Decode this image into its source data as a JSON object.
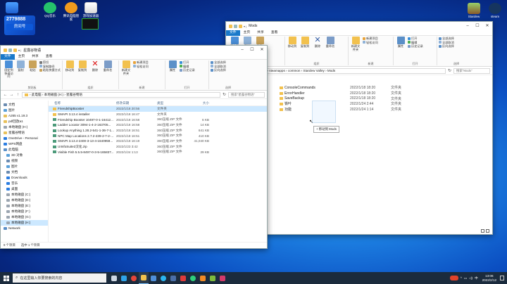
{
  "desktop": {
    "icons": [
      {
        "label": "房间号",
        "color": "#2a7de1",
        "id": "room"
      },
      {
        "label": "QQ音乐",
        "color": "#25c26b",
        "id": "qqmusic"
      },
      {
        "label": "腾讯电脑管家",
        "color": "#f09a1e",
        "id": "pcmgr"
      },
      {
        "label": "游戏加速器",
        "color": "#e83b3b",
        "id": "booster"
      },
      {
        "label": "Stardew",
        "color": "#8a5a2b",
        "id": "stardew"
      },
      {
        "label": "steam",
        "color": "#16355f",
        "id": "steam"
      }
    ],
    "banner_label": "房间号",
    "banner_number": "2779888"
  },
  "modsWindow": {
    "title": "Mods",
    "tabs": [
      "文件",
      "主页",
      "共享",
      "查看"
    ],
    "ribbon": {
      "clipboard": {
        "name": "剪贴板",
        "pin": "固定到快速访问",
        "copy": "复制",
        "paste": "粘贴"
      },
      "organize": {
        "name": "组织",
        "move_to": "移动到",
        "copy_to": "复制到",
        "delete": "删除",
        "rename": "重命名"
      },
      "new": {
        "name": "新建",
        "new_item": "新建项目",
        "easy_access": "轻松访问",
        "new_folder": "新建文件夹"
      },
      "open": {
        "name": "打开",
        "properties": "属性",
        "open": "打开",
        "edit": "编辑",
        "history": "历史记录"
      },
      "select": {
        "name": "选择",
        "select_all": "全部选择",
        "select_none": "全部取消",
        "invert": "反向选择"
      }
    },
    "breadcrumb": "team › steamapps › common › Stardew Valley › Mods",
    "search_placeholder": "搜索\"Mods\"",
    "items": [
      {
        "name": "ConsoleCommands",
        "date": "2022/1/18 18:20",
        "type": "文件夹"
      },
      {
        "name": "ErrorHandler",
        "date": "2022/1/18 18:20",
        "type": "文件夹"
      },
      {
        "name": "SaveBackup",
        "date": "2022/1/18 18:20",
        "type": "文件夹"
      },
      {
        "name": "铁叶",
        "date": "2022/1/24 2:44",
        "type": "文件夹"
      },
      {
        "name": "功能",
        "date": "2022/1/24 1:14",
        "type": "文件夹"
      }
    ],
    "drag_tooltip": "+ 移动到 Mods"
  },
  "mainWindow": {
    "title": "星露谷物语",
    "tabs": [
      "文件",
      "主页",
      "共享",
      "查看"
    ],
    "ribbon": {
      "clipboard": {
        "name": "剪贴板",
        "pin": "固定到快速访问",
        "copy": "复制",
        "paste": "粘贴",
        "copy_path": "复制路径",
        "paste_shortcut": "粘贴快捷方式",
        "cut": "剪切"
      },
      "organize": {
        "name": "组织",
        "move_to": "移动到",
        "copy_to": "复制到",
        "delete": "删除",
        "rename": "重命名"
      },
      "new": {
        "name": "新建",
        "new_item": "新建项目",
        "easy_access": "轻松访问",
        "new_folder": "新建文件夹"
      },
      "open": {
        "name": "打开",
        "properties": "属性",
        "open": "打开",
        "edit": "编辑",
        "history": "历史记录"
      },
      "select": {
        "name": "选择",
        "select_all": "全部选择",
        "select_none": "全部取消",
        "invert": "反向选择"
      }
    },
    "breadcrumb": "› 此电脑 › 本地磁盘 (H:) › 星露谷物语",
    "search_placeholder": "搜索\"星露谷物语\"",
    "nav": [
      {
        "label": "文档",
        "color": "#6a8bb0"
      },
      {
        "label": "图片",
        "color": "#5aa0d8"
      },
      {
        "label": "A265 v1.19.3",
        "color": "#e8c15a"
      },
      {
        "label": "pdf回放a1",
        "color": "#e8c15a"
      },
      {
        "label": "本地磁盘 (H:)",
        "color": "#9aa5b0"
      },
      {
        "label": "星露谷物语",
        "color": "#e8c15a"
      },
      {
        "label": "OneDrive - Personal",
        "color": "#2a7de1"
      },
      {
        "label": "WPS网盘",
        "color": "#2a7de1"
      },
      {
        "label": "此电脑",
        "color": "#5a8fc8"
      },
      {
        "label": "3D 对象",
        "color": "#5aa0d8"
      },
      {
        "label": "视频",
        "color": "#6a8bb0"
      },
      {
        "label": "图片",
        "color": "#5aa0d8"
      },
      {
        "label": "文档",
        "color": "#6a8bb0"
      },
      {
        "label": "Downloads",
        "color": "#2a7de1"
      },
      {
        "label": "音乐",
        "color": "#2a7de1"
      },
      {
        "label": "桌面",
        "color": "#2a7de1"
      },
      {
        "label": "本地磁盘 (C:)",
        "color": "#9aa5b0"
      },
      {
        "label": "本地磁盘 (D:)",
        "color": "#9aa5b0"
      },
      {
        "label": "本地磁盘 (E:)",
        "color": "#9aa5b0"
      },
      {
        "label": "本地磁盘 (F:)",
        "color": "#9aa5b0"
      },
      {
        "label": "本地磁盘 (G:)",
        "color": "#9aa5b0"
      },
      {
        "label": "本地磁盘 (H:)",
        "color": "#9aa5b0"
      },
      {
        "label": "Network",
        "color": "#5a8fc8"
      }
    ],
    "columns": {
      "name": "名称",
      "date": "修改日期",
      "type": "类型",
      "size": "大小"
    },
    "files": [
      {
        "name": "FriendshipBooster",
        "date": "2022/1/18 20:56",
        "type": "文件夹",
        "size": "",
        "kind": "folder"
      },
      {
        "name": "SMAPI 3.13.4 installer",
        "date": "2022/1/18 16:47",
        "type": "文件夹",
        "size": "",
        "kind": "folder"
      },
      {
        "name": "Friendship Booster 10497-0-1-16412...",
        "date": "2022/1/18 16:58",
        "type": "360压缩 ZIP 文件",
        "size": "6 KB",
        "kind": "zip"
      },
      {
        "name": "Ladder Locator 3094-1-4-2-163705...",
        "date": "2022/1/18 16:58",
        "type": "360压缩 ZIP 文件",
        "size": "14 KB",
        "kind": "zip"
      },
      {
        "name": "Lookup Anything 1.28.2-541-1-36-7-1...",
        "date": "2022/1/18 16:51",
        "type": "360压缩 ZIP 文件",
        "size": "641 KB",
        "kind": "zip"
      },
      {
        "name": "NPC Map Locations 2.7.2-239-2-7-2-...",
        "date": "2022/1/18 16:51",
        "type": "360压缩 ZIP 文件",
        "size": "410 KB",
        "kind": "zip"
      },
      {
        "name": "SMAPI 3.13.4-2400-3-13-4-1640959...",
        "date": "2022/1/18 16:19",
        "type": "360压缩 ZIP 文件",
        "size": "41,040 KB",
        "kind": "zip"
      },
      {
        "name": "UIInfoSuite2汉化.zip",
        "date": "2022/1/23 3:42",
        "type": "360压缩 ZIP 文件",
        "size": "",
        "kind": "zip"
      },
      {
        "name": "Visible Fish 5.5.5-8497-0-3-5-165837...",
        "date": "2022/1/24 1:13",
        "type": "360压缩 ZIP 文件",
        "size": "29 KB",
        "kind": "zip"
      }
    ],
    "status": {
      "count": "9 个项目",
      "selected": "选中 1 个项目"
    }
  },
  "taskbar": {
    "search_placeholder": "在这里输入你要搜索的内容",
    "apps": [
      {
        "id": "taskview",
        "color": "#cfd8e3"
      },
      {
        "id": "edge",
        "color": "#2fa3e8"
      },
      {
        "id": "chrome",
        "color": "#e5463a"
      },
      {
        "id": "explorer",
        "color": "#f2c14e"
      },
      {
        "id": "store",
        "color": "#4f8fd9"
      },
      {
        "id": "qq",
        "color": "#2bb5f0"
      },
      {
        "id": "steam",
        "color": "#4b6fa8"
      },
      {
        "id": "wps",
        "color": "#e03b3b"
      },
      {
        "id": "music",
        "color": "#2fcf7a"
      },
      {
        "id": "stardew",
        "color": "#f08a26"
      },
      {
        "id": "game",
        "color": "#7dbb3c"
      },
      {
        "id": "media",
        "color": "#d33a6a"
      }
    ],
    "ime": "中",
    "time": "13:06",
    "date": "2022/2/12"
  },
  "colors": {
    "accent": "#1979ca",
    "selection": "#cce8ff",
    "folder": "#f2c14e",
    "zip": "#4c9a7a"
  }
}
